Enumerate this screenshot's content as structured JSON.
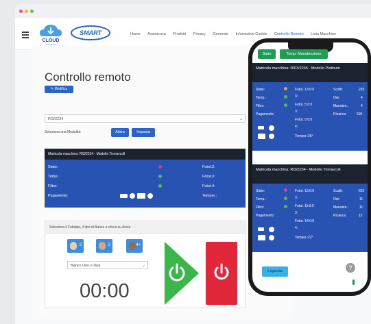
{
  "nav": {
    "logo_text": "CLOUD",
    "logo_sub": "SOLUTION",
    "brand": "SMART",
    "items": [
      "Home",
      "Assistenza",
      "Prodotti",
      "Privacy",
      "Generale",
      "Informative Cookie",
      "Controllo Remoto",
      "Lista Macchine"
    ],
    "active_index": 6
  },
  "page": {
    "title": "Controllo remoto",
    "modify_label": "Modifica",
    "machine_select": "RI3/2234",
    "select_mode_label": "Seleziona una Modalità:",
    "attiva_label": "Attiva",
    "imposta_label": "Imposta"
  },
  "status_card": {
    "header": "Matricola macchina: RI3/2234 - Modello Tronavcoll",
    "rows": [
      {
        "label": "Stato:",
        "indicator": "#e63a5a",
        "right": "Fotot.2:"
      },
      {
        "label": "Temp.:",
        "indicator": "#55c041",
        "right": "Fotot.3:"
      },
      {
        "label": "Filtro:",
        "indicator": "#55c041",
        "right": "Fotot.4:"
      },
      {
        "label": "Pagamento:",
        "indicator": "",
        "right": "Temper.:"
      }
    ]
  },
  "control_panel": {
    "header": "Seleziona il Fototipo, il tipo di Banco e clicca su Avvia",
    "phototype_badges": [
      "2",
      "3",
      "4+"
    ],
    "bench_select": "Banco Uno e Due",
    "timer": "00:00"
  },
  "phone": {
    "buttons": [
      "Stato",
      "Temp. Manutenzione"
    ],
    "cards": [
      {
        "header": "Matricola macchina: RI03/2245 - Modello Platinum",
        "rows": [
          {
            "label": "Stato:",
            "indicator": "#f0a020",
            "mid": "Fotot. 13:0:0",
            "right_label": "Scatti:",
            "right_val": "293"
          },
          {
            "label": "Temp.:",
            "indicator": "#55c041",
            "mid": "3:",
            "right_label": "Ore:",
            "right_val": "4"
          },
          {
            "label": "Filtro:",
            "indicator": "#55c041",
            "mid": "Fotot. 5:0:0",
            "right_label": "Manuten.:",
            "right_val": "4"
          },
          {
            "label": "Pagamento:",
            "indicator": "",
            "mid": "3:",
            "right_label": "Ricarica:",
            "right_val": "500"
          }
        ],
        "extra": [
          "Fotot. 0:0:0",
          "4:",
          "Temper.:26°"
        ]
      },
      {
        "header": "Matricola macchina: RI3/2234 - Modello Tronavcoll",
        "rows": [
          {
            "label": "Stato:",
            "indicator": "#e63a9a",
            "mid": "Fotot. 13:0:0",
            "right_label": "Scatti:",
            "right_val": "622"
          },
          {
            "label": "Temp.:",
            "indicator": "#55c041",
            "mid": "3:",
            "right_label": "Ore:",
            "right_val": "11"
          },
          {
            "label": "Filtro:",
            "indicator": "#55c041",
            "mid": "Fotot. 11:0:0",
            "right_label": "Manuten.:",
            "right_val": "11"
          },
          {
            "label": "Pagamento:",
            "indicator": "",
            "mid": "3:",
            "right_label": "Ricarica:",
            "right_val": "12"
          }
        ],
        "extra": [
          "Fotot. 14:0:0",
          "4:",
          "Temper.:22°"
        ]
      }
    ],
    "legenda_label": "Legenda"
  },
  "colors": {
    "primary": "#2a63c9",
    "card_blue": "#2953b2",
    "dark_header": "#1c2230",
    "start_green": "#3cb54a",
    "stop_red": "#e0283a"
  }
}
